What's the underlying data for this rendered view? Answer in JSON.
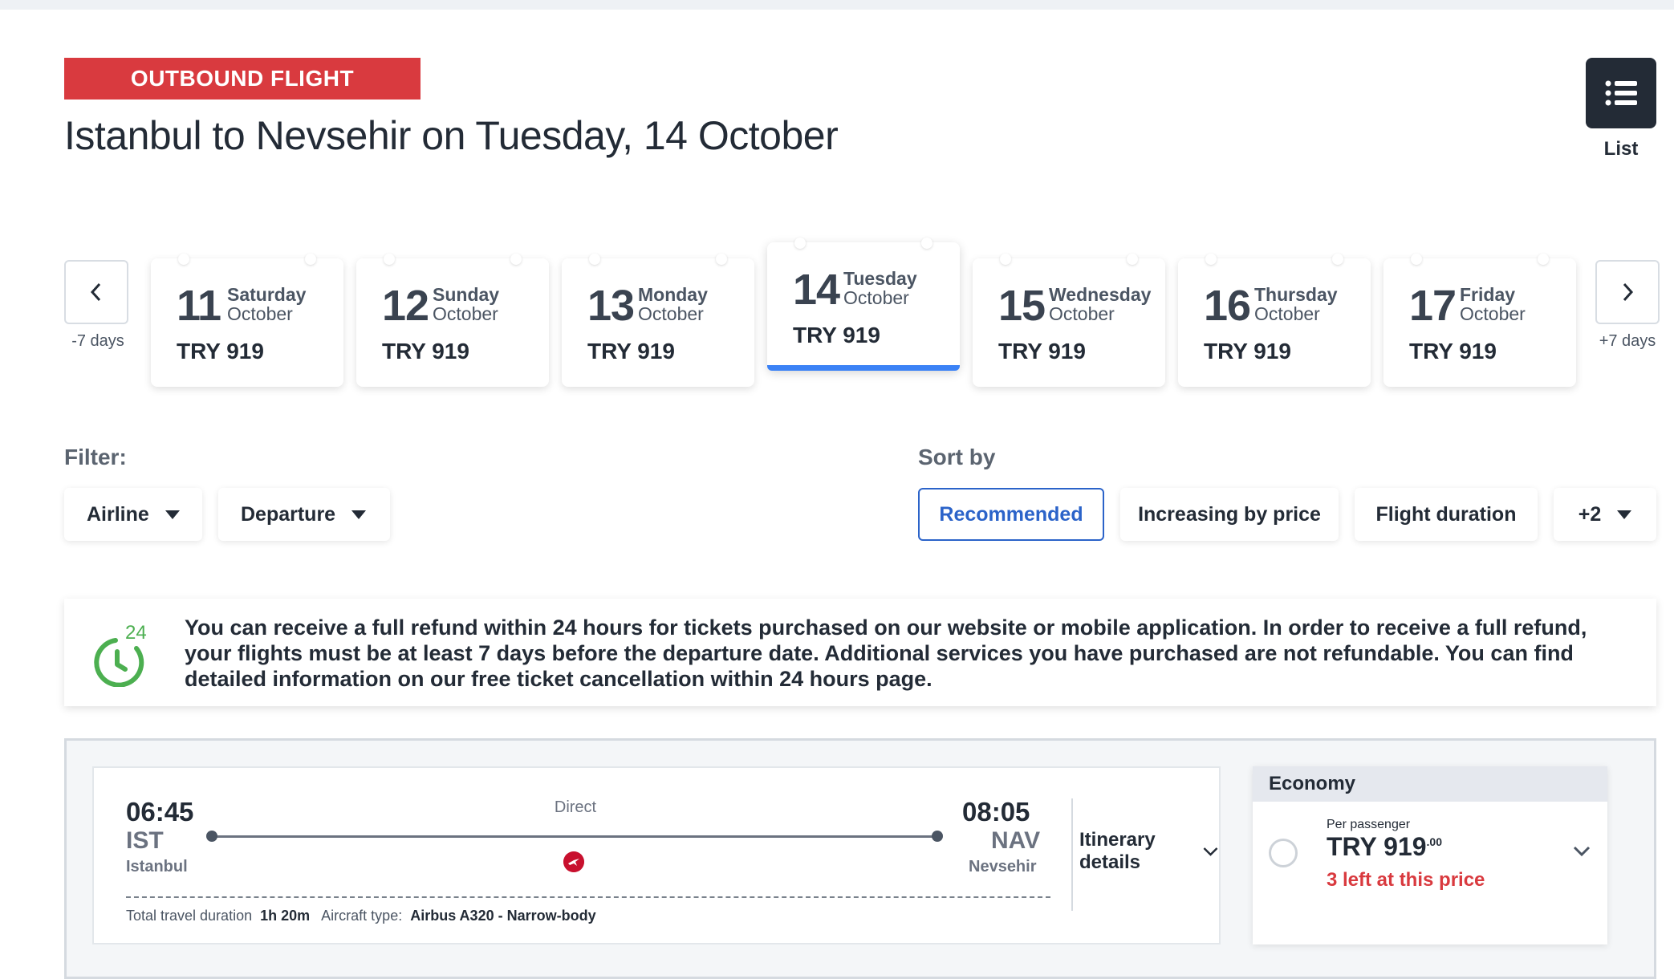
{
  "header": {
    "badge": "OUTBOUND FLIGHT",
    "title": "Istanbul to Nevsehir on Tuesday, 14 October",
    "list_label": "List"
  },
  "carousel": {
    "prev_caption": "-7 days",
    "next_caption": "+7 days",
    "dates": [
      {
        "day": "11",
        "weekday": "Saturday",
        "month": "October",
        "price": "TRY 919"
      },
      {
        "day": "12",
        "weekday": "Sunday",
        "month": "October",
        "price": "TRY 919"
      },
      {
        "day": "13",
        "weekday": "Monday",
        "month": "October",
        "price": "TRY 919"
      },
      {
        "day": "14",
        "weekday": "Tuesday",
        "month": "October",
        "price": "TRY 919"
      },
      {
        "day": "15",
        "weekday": "Wednesday",
        "month": "October",
        "price": "TRY 919"
      },
      {
        "day": "16",
        "weekday": "Thursday",
        "month": "October",
        "price": "TRY 919"
      },
      {
        "day": "17",
        "weekday": "Friday",
        "month": "October",
        "price": "TRY 919"
      }
    ]
  },
  "filter": {
    "label": "Filter:",
    "airline": "Airline",
    "departure": "Departure"
  },
  "sort": {
    "label": "Sort by",
    "recommended": "Recommended",
    "price": "Increasing by price",
    "duration": "Flight duration",
    "more": "+2"
  },
  "refund": {
    "icon_number": "24",
    "text": "You can receive a full refund within 24 hours for tickets purchased on our website or mobile application. In order to receive a full refund, your flights must be at least 7 days before the departure date. Additional services you have purchased are not refundable. You can find detailed information on our free ticket cancellation within 24 hours page."
  },
  "flight": {
    "dep_time": "06:45",
    "dep_code": "IST",
    "dep_city": "Istanbul",
    "arr_time": "08:05",
    "arr_code": "NAV",
    "arr_city": "Nevsehir",
    "stops": "Direct",
    "duration_label": "Total travel duration",
    "duration": "1h 20m",
    "aircraft_label": "Aircraft type:",
    "aircraft": "Airbus A320 - Narrow-body",
    "itinerary": "Itinerary details"
  },
  "economy": {
    "title": "Economy",
    "per_passenger": "Per passenger",
    "price": "TRY 919",
    "price_cents": ".00",
    "availability": "3 left at this price"
  }
}
